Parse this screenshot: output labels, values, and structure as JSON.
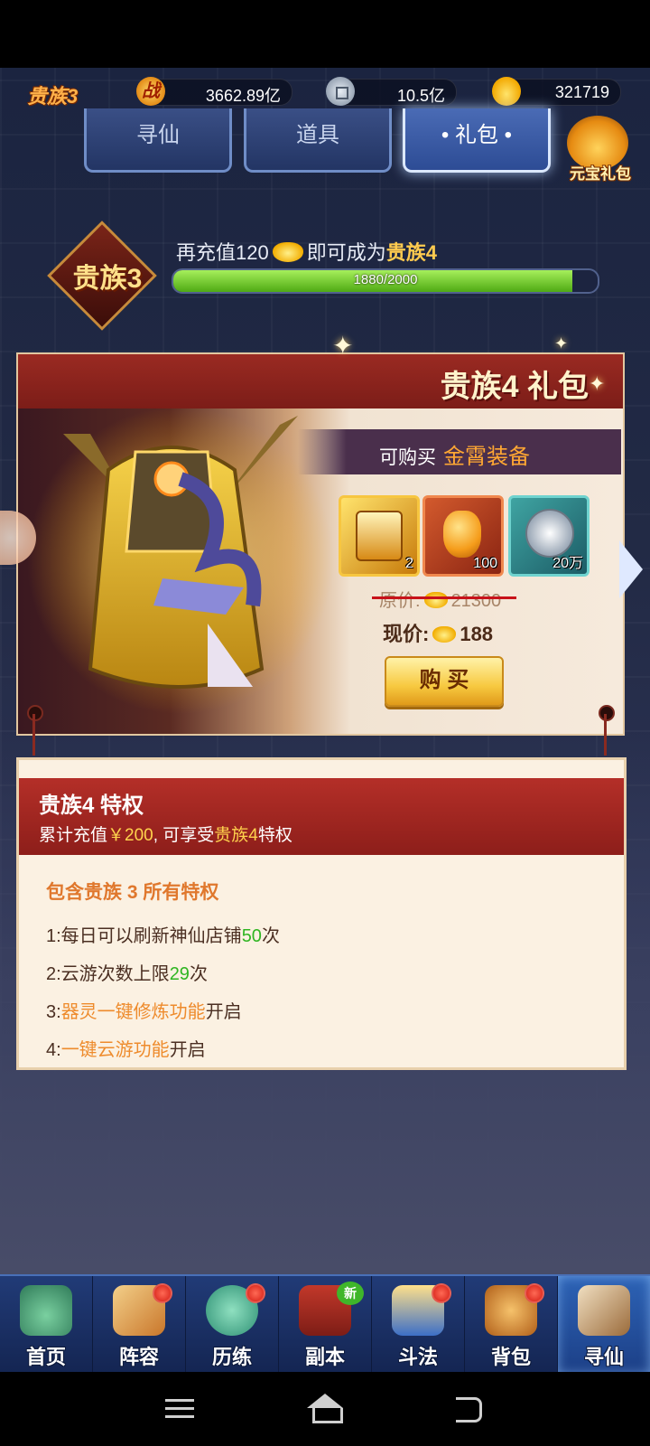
{
  "top": {
    "rank": "贵族3",
    "battle_icon_glyph": "战",
    "battle_power": "3662.89亿",
    "silver": "10.5亿",
    "gold": "321719"
  },
  "tabs": [
    {
      "label": "寻仙"
    },
    {
      "label": "道具"
    },
    {
      "label": "• 礼包 •",
      "active": true
    }
  ],
  "gift_button": {
    "label": "元宝礼包",
    "icon": "gold-ingot-bag-icon"
  },
  "vip": {
    "badge": "贵族3",
    "prefix": "再充值120",
    "middle": "即可成为",
    "next": "贵族4",
    "progress_text": "1880/2000",
    "progress_fraction": 0.94
  },
  "package": {
    "title": "贵族4 礼包",
    "subtitle_prefix": "可购买",
    "subtitle_highlight": "金霄装备",
    "items": [
      {
        "icon": "equipment-chest-icon",
        "count": "2"
      },
      {
        "icon": "orange-gem-icon",
        "count": "100"
      },
      {
        "icon": "silver-coin-icon",
        "count": "20万"
      }
    ],
    "original_label": "原价:",
    "original_price": "21300",
    "current_label": "现价:",
    "current_price": "188",
    "buy_label": "购 买"
  },
  "privilege": {
    "title": "贵族4 特权",
    "sub_prefix": "累计充值",
    "sub_amount": "￥200",
    "sub_middle": ", 可享受",
    "sub_rank": "贵族4",
    "sub_suffix": "特权",
    "list_head": "包含贵族 3 所有特权",
    "rows": [
      {
        "prefix": "1:每日可以刷新神仙店铺",
        "hl": "50",
        "suffix": "次"
      },
      {
        "prefix": "2:云游次数上限",
        "hl": "29",
        "suffix": "次"
      },
      {
        "prefix": "3:",
        "hl": "器灵一键修炼功能",
        "suffix": "开启"
      },
      {
        "prefix": "4:",
        "hl": "一键云游功能",
        "suffix": "开启"
      }
    ]
  },
  "bottom_nav": [
    {
      "label": "首页",
      "icon": "home-landscape-icon",
      "dot": false
    },
    {
      "label": "阵容",
      "icon": "cards-lineup-icon",
      "dot": true
    },
    {
      "label": "历练",
      "icon": "gourd-training-icon",
      "dot": true
    },
    {
      "label": "副本",
      "icon": "temple-gate-icon",
      "badge": "新"
    },
    {
      "label": "斗法",
      "icon": "battle-tower-icon",
      "dot": true
    },
    {
      "label": "背包",
      "icon": "backpack-icon",
      "dot": true
    },
    {
      "label": "寻仙",
      "icon": "scroll-icon",
      "active": true
    }
  ],
  "system_nav": [
    "menu-icon",
    "home-icon",
    "back-icon"
  ]
}
